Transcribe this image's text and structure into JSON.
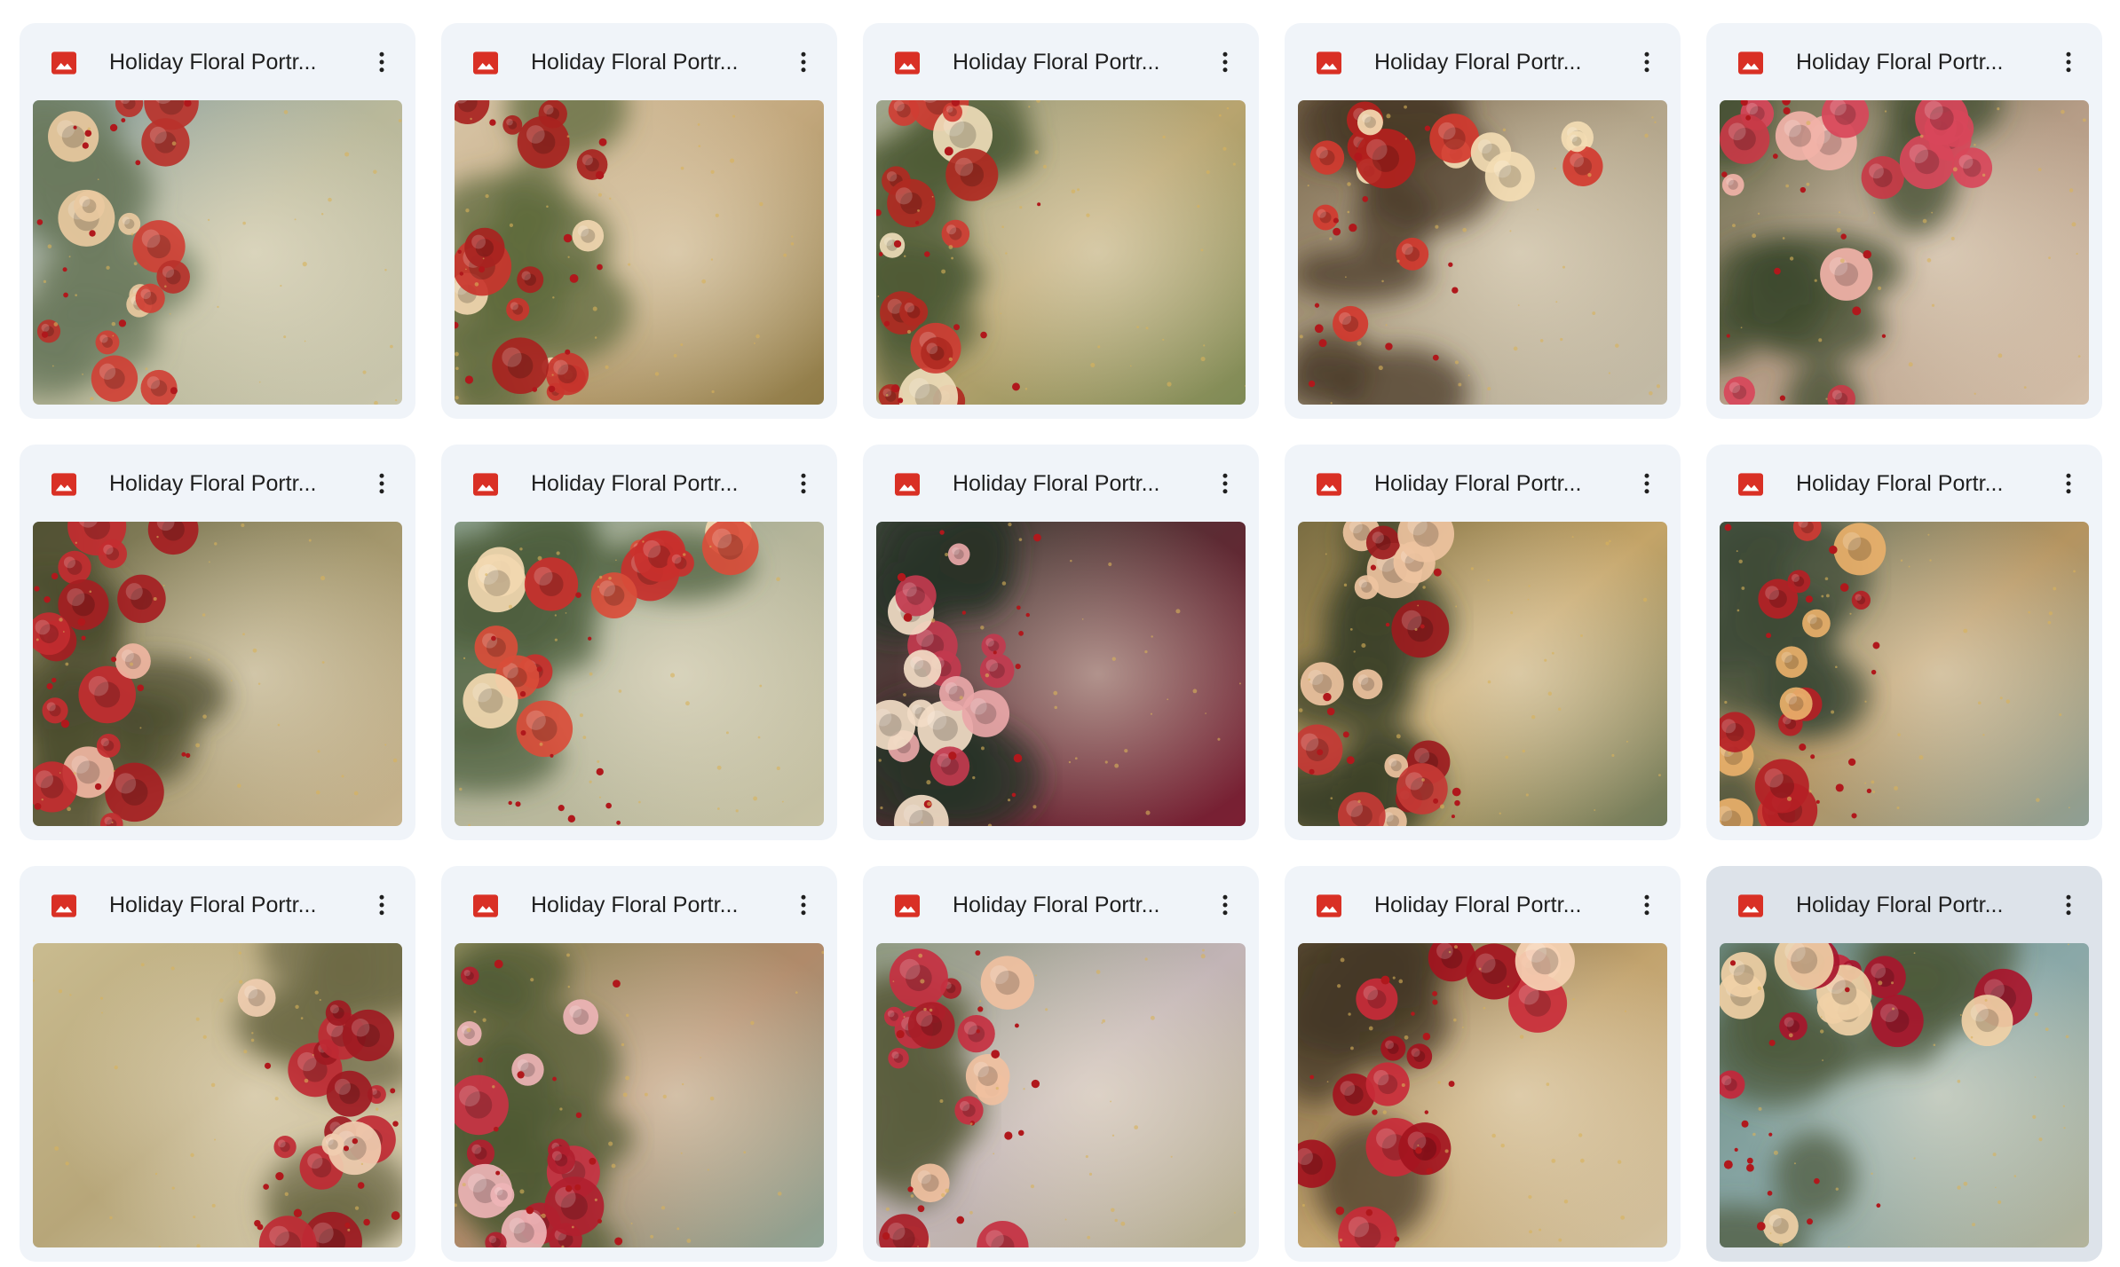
{
  "files": [
    {
      "title": "Holiday Floral Portr...",
      "file_type": "image",
      "selected": false,
      "palette": {
        "bg": [
          "#8fa5a6",
          "#b9b89a",
          "#c9c6ad"
        ],
        "edge": "#6b7a5d",
        "flower": [
          "#b8322b",
          "#e9c9a0",
          "#d04035"
        ],
        "side": "left"
      }
    },
    {
      "title": "Holiday Floral Portr...",
      "file_type": "image",
      "selected": false,
      "palette": {
        "bg": [
          "#d7c4a6",
          "#c2a77c",
          "#8e7a45"
        ],
        "edge": "#5e6a3c",
        "flower": [
          "#a8231f",
          "#f1d6b0",
          "#c9352d"
        ],
        "side": "left"
      }
    },
    {
      "title": "Holiday Floral Portr...",
      "file_type": "image",
      "selected": false,
      "palette": {
        "bg": [
          "#9ea58d",
          "#b8a46f",
          "#7e8a55"
        ],
        "edge": "#4f5b36",
        "flower": [
          "#b02a22",
          "#eedcb8",
          "#cf3d33"
        ],
        "side": "left"
      }
    },
    {
      "title": "Holiday Floral Portr...",
      "file_type": "image",
      "selected": false,
      "palette": {
        "bg": [
          "#7d6a4f",
          "#b3a58a",
          "#c4bca8"
        ],
        "edge": "#4a3b28",
        "flower": [
          "#b3211d",
          "#f3dcb3",
          "#d2392f"
        ],
        "side": "top-left"
      }
    },
    {
      "title": "Holiday Floral Portr...",
      "file_type": "image",
      "selected": false,
      "palette": {
        "bg": [
          "#6b6f50",
          "#b59c86",
          "#d4bfa9"
        ],
        "edge": "#3e4a2e",
        "flower": [
          "#c83a47",
          "#f1b2a8",
          "#d8465a"
        ],
        "side": "top-left"
      }
    },
    {
      "title": "Holiday Floral Portr...",
      "file_type": "image",
      "selected": false,
      "palette": {
        "bg": [
          "#6c6b4a",
          "#a3966c",
          "#c8b48e"
        ],
        "edge": "#4a4b2d",
        "flower": [
          "#a51e22",
          "#f0b6a2",
          "#c32c30"
        ],
        "side": "left"
      }
    },
    {
      "title": "Holiday Floral Portr...",
      "file_type": "image",
      "selected": false,
      "palette": {
        "bg": [
          "#8a9f8c",
          "#b5b59a",
          "#c7c2a4"
        ],
        "edge": "#4e5f3e",
        "flower": [
          "#c9302c",
          "#f2d8b0",
          "#d94d3a"
        ],
        "side": "top-left"
      }
    },
    {
      "title": "Holiday Floral Portr...",
      "file_type": "image",
      "selected": false,
      "palette": {
        "bg": [
          "#3e4a3c",
          "#5e2a33",
          "#7b1f33"
        ],
        "edge": "#2a3328",
        "flower": [
          "#e9a7a8",
          "#f2dcc6",
          "#c23a4e"
        ],
        "side": "left"
      }
    },
    {
      "title": "Holiday Floral Portr...",
      "file_type": "image",
      "selected": false,
      "palette": {
        "bg": [
          "#7a6d42",
          "#c4a468",
          "#6f7a5a"
        ],
        "edge": "#3b4028",
        "flower": [
          "#9c1b1e",
          "#eec3a0",
          "#c53a35"
        ],
        "side": "left"
      }
    },
    {
      "title": "Holiday Floral Portr...",
      "file_type": "image",
      "selected": false,
      "palette": {
        "bg": [
          "#5f7366",
          "#b59460",
          "#8e9f94"
        ],
        "edge": "#3d4a35",
        "flower": [
          "#b51f25",
          "#e9b06a",
          "#cf3a33"
        ],
        "side": "left"
      }
    },
    {
      "title": "Holiday Floral Portr...",
      "file_type": "image",
      "selected": false,
      "palette": {
        "bg": [
          "#c9bb8f",
          "#b7a679",
          "#d9d0b5"
        ],
        "edge": "#6e6a46",
        "flower": [
          "#9e1a22",
          "#f0cdb0",
          "#c02a34"
        ],
        "side": "right"
      }
    },
    {
      "title": "Holiday Floral Portr...",
      "file_type": "image",
      "selected": false,
      "palette": {
        "bg": [
          "#8b8a5c",
          "#b08a6a",
          "#8ea394"
        ],
        "edge": "#4f5a33",
        "flower": [
          "#b11f2f",
          "#eeb4b6",
          "#c93344"
        ],
        "side": "left"
      }
    },
    {
      "title": "Holiday Floral Portr...",
      "file_type": "image",
      "selected": false,
      "palette": {
        "bg": [
          "#8f9a82",
          "#c2b4b6",
          "#b7b08f"
        ],
        "edge": "#5b5e3e",
        "flower": [
          "#a91d27",
          "#f0c0a0",
          "#c53041"
        ],
        "side": "left"
      }
    },
    {
      "title": "Holiday Floral Portr...",
      "file_type": "image",
      "selected": false,
      "palette": {
        "bg": [
          "#6d5a3d",
          "#c2a36e",
          "#d3c2a0"
        ],
        "edge": "#453a25",
        "flower": [
          "#a3141e",
          "#f6d3b4",
          "#c92b38"
        ],
        "side": "top-left"
      }
    },
    {
      "title": "Holiday Floral Portr...",
      "file_type": "image",
      "selected": true,
      "palette": {
        "bg": [
          "#6f8e84",
          "#8aa8a8",
          "#b3b39b"
        ],
        "edge": "#4d5a3c",
        "flower": [
          "#a8162c",
          "#f0d0a6",
          "#c4263b"
        ],
        "side": "top-left"
      }
    }
  ],
  "icons": {
    "file_type_icon": "image-icon",
    "menu_icon": "more-vert-icon"
  },
  "colors": {
    "image_icon_red": "#d93025",
    "card_bg": "#f0f4f9",
    "card_selected_bg": "#dde3ea"
  }
}
